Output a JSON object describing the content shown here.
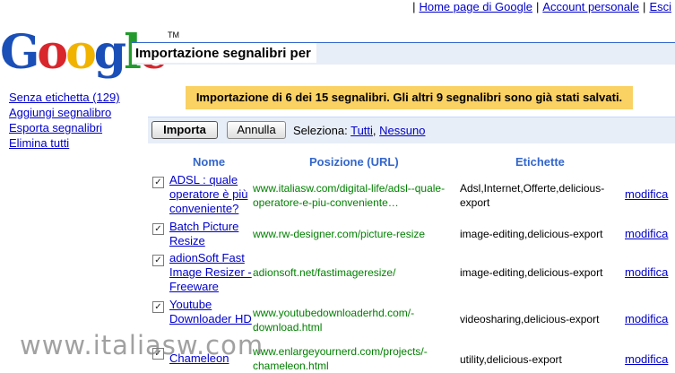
{
  "top_links": {
    "home": "Home page di Google",
    "account": "Account personale",
    "exit": "Esci"
  },
  "logo": {
    "letters": [
      "G",
      "o",
      "o",
      "g",
      "l",
      "e"
    ],
    "colors": [
      "#1a4fb8",
      "#d8262c",
      "#f1b300",
      "#1a4fb8",
      "#239b2c",
      "#d8262c"
    ],
    "tm": "TM"
  },
  "header": {
    "title": "Importazione segnalibri per"
  },
  "sidebar": {
    "items": [
      {
        "label": "Senza etichetta (129)"
      },
      {
        "label": "Aggiungi segnalibro"
      },
      {
        "label": "Esporta segnalibri"
      },
      {
        "label": "Elimina tutti"
      }
    ]
  },
  "notice": "Importazione di 6 dei 15 segnalibri. Gli altri 9 segnalibri sono già stati salvati.",
  "toolbar": {
    "import_label": "Importa",
    "cancel_label": "Annulla",
    "select_label": "Seleziona:",
    "all": "Tutti",
    "none": "Nessuno"
  },
  "table": {
    "columns": {
      "name": "Nome",
      "url": "Posizione (URL)",
      "labels": "Etichette"
    },
    "rows": [
      {
        "name": "ADSL : quale operatore è più conveniente?",
        "url": "www.italiasw.com/digital-life/adsl--quale-operatore-e-piu-conveniente…",
        "labels": "Adsl,Internet,Offerte,delicious-export",
        "edit": "modifica",
        "checked": true
      },
      {
        "name": "Batch Picture Resize",
        "url": "www.rw-designer.com/picture-resize",
        "labels": "image-editing,delicious-export",
        "edit": "modifica",
        "checked": true
      },
      {
        "name": "adionSoft Fast Image Resizer - Freeware",
        "url": "adionsoft.net/fastimageresize/",
        "labels": "image-editing,delicious-export",
        "edit": "modifica",
        "checked": true
      },
      {
        "name": "Youtube Downloader HD",
        "url": "www.youtubedownloaderhd.com/-download.html",
        "labels": "videosharing,delicious-export",
        "edit": "modifica",
        "checked": true
      },
      {
        "name": "Chameleon",
        "url": "www.enlargeyournerd.com/projects/-chameleon.html",
        "labels": "utility,delicious-export",
        "edit": "modifica",
        "checked": true
      }
    ]
  },
  "watermark": "www.italiasw.com"
}
